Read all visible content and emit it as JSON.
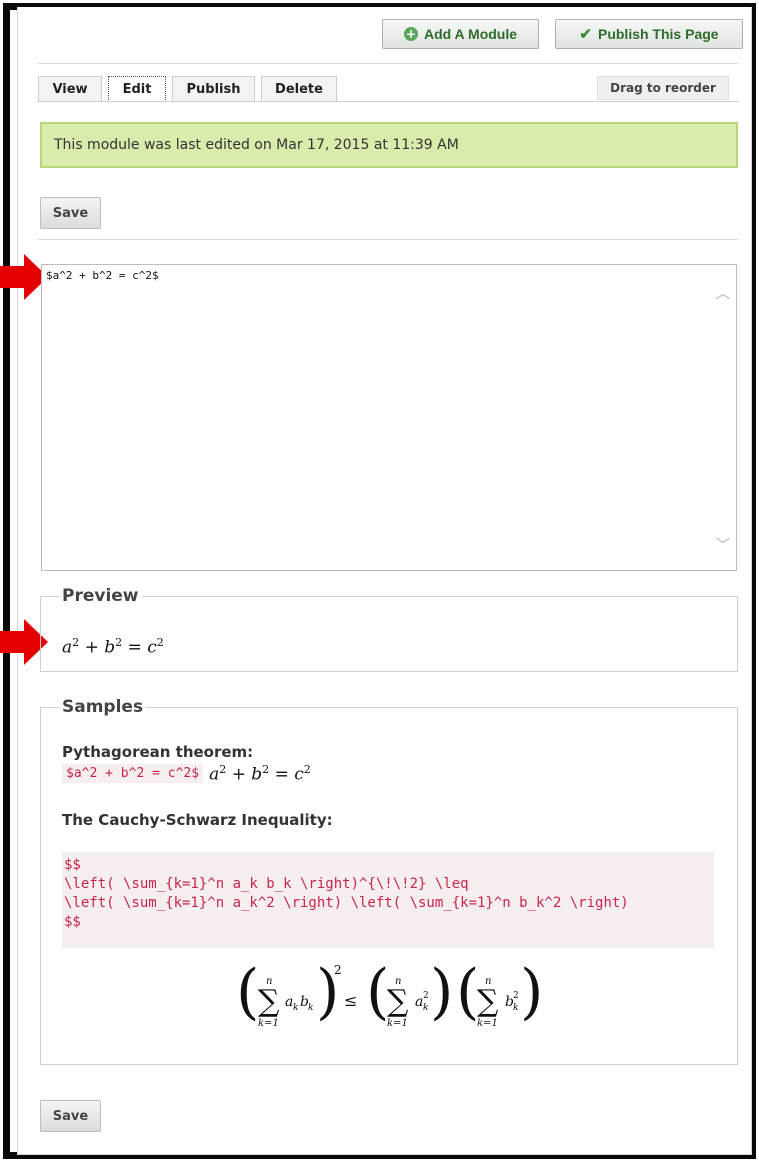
{
  "toolbar": {
    "add_module_label": "Add A Module",
    "publish_page_label": "Publish This Page"
  },
  "tabs": [
    {
      "label": "View",
      "active": false
    },
    {
      "label": "Edit",
      "active": true
    },
    {
      "label": "Publish",
      "active": false
    },
    {
      "label": "Delete",
      "active": false
    }
  ],
  "drag_label": "Drag to reorder",
  "notice": "This module was last edited on Mar 17, 2015 at 11:39 AM",
  "save_label": "Save",
  "editor": {
    "value": "$a^2 + b^2 = c^2$"
  },
  "preview": {
    "legend": "Preview"
  },
  "samples": {
    "legend": "Samples",
    "pythagorean": {
      "title": "Pythagorean theorem:",
      "code": "$a^2 + b^2 = c^2$"
    },
    "cauchy": {
      "title": "The Cauchy-Schwarz Inequality:",
      "code_lines": [
        "$$",
        "\\left( \\sum_{k=1}^n a_k b_k \\right)^{\\!\\!2} \\leq",
        "\\left( \\sum_{k=1}^n a_k^2 \\right) \\left( \\sum_{k=1}^n b_k^2 \\right)",
        "$$"
      ]
    }
  },
  "colors": {
    "notice_bg": "#d9ecac",
    "notice_border": "#b9d57a",
    "code_color": "#c7254e",
    "arrow_red": "#e50000"
  }
}
